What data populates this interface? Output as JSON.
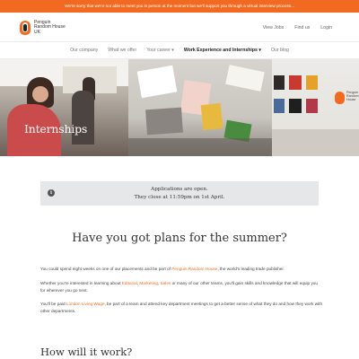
{
  "banner": {
    "text": "We're sorry that we're not able to meet you in person at the moment but we'll support you through a virtual interview process..."
  },
  "header": {
    "logo_text_line1": "Penguin",
    "logo_text_line2": "Random House",
    "logo_text_line3": "UK",
    "util_nav": [
      "View Jobs",
      "Find us",
      "Login"
    ]
  },
  "main_nav": {
    "items": [
      "Our company",
      "What we offer",
      "Your career ▾",
      "Work Experience and Internships ▾",
      "Our blog"
    ],
    "active_index": 3
  },
  "hero": {
    "title": "Internships"
  },
  "notice": {
    "line1": "Applications are open.",
    "line2": "They close at 11:59pm on 1st April.",
    "icon": "info-icon"
  },
  "content": {
    "heading": "Have you got plans for the summer?",
    "p1_a": "You could spend eight weeks on one of our placements and be part of ",
    "p1_link": "Penguin Random House",
    "p1_b": ", the world's leading trade publisher.",
    "p2_a": "Whether you're interested in learning about ",
    "p2_link1": "Editorial",
    "p2_sep1": ", ",
    "p2_link2": "Marketing",
    "p2_sep2": ", ",
    "p2_link3": "Sales",
    "p2_b": " or many of our other teams, you'll gain skills and knowledge that will equip you for wherever you go next.",
    "p3_a": "You'll be paid ",
    "p3_link": "London Living Wage",
    "p3_b": ", be part of a team and attend key department meetings to get a better sense of what they do and how they work with other departments.",
    "subheading": "How will it work?"
  },
  "colors": {
    "accent": "#f26a21",
    "notice_bg": "#e6e7e8"
  }
}
